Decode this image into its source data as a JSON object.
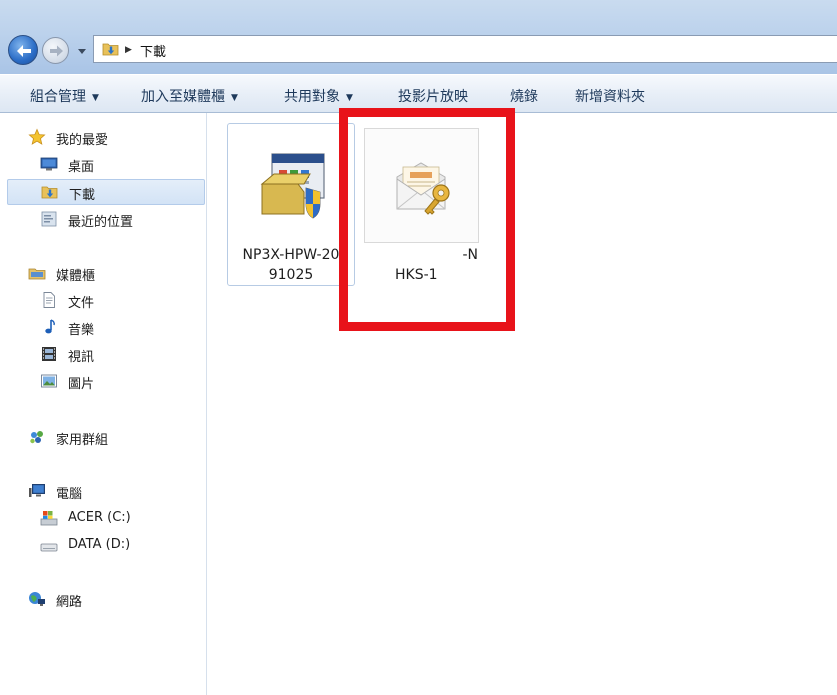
{
  "window": {
    "address": {
      "path": "下載",
      "separator_icon": "chevron-right-icon"
    },
    "buttons": {
      "back_icon": "back-arrow-icon",
      "forward_icon": "forward-arrow-icon",
      "history_icon": "chevron-down-icon"
    }
  },
  "toolbar": {
    "items": [
      {
        "label": "組合管理",
        "has_dropdown": true
      },
      {
        "label": "加入至媒體櫃",
        "has_dropdown": true
      },
      {
        "label": "共用對象",
        "has_dropdown": true
      },
      {
        "label": "投影片放映",
        "has_dropdown": false
      },
      {
        "label": "燒錄",
        "has_dropdown": false
      },
      {
        "label": "新增資料夾",
        "has_dropdown": false
      }
    ],
    "dropdown_glyph": "▼"
  },
  "sidebar": {
    "favorites": {
      "label": "我的最愛",
      "icon": "star-icon",
      "items": [
        {
          "label": "桌面",
          "icon": "desktop-icon"
        },
        {
          "label": "下載",
          "icon": "downloads-folder-icon",
          "selected": true
        },
        {
          "label": "最近的位置",
          "icon": "recent-places-icon"
        }
      ]
    },
    "libraries": {
      "label": "媒體櫃",
      "icon": "library-icon",
      "items": [
        {
          "label": "文件",
          "icon": "document-icon"
        },
        {
          "label": "音樂",
          "icon": "music-icon"
        },
        {
          "label": "視訊",
          "icon": "video-icon"
        },
        {
          "label": "圖片",
          "icon": "picture-icon"
        }
      ]
    },
    "homegroup": {
      "label": "家用群組",
      "icon": "homegroup-icon"
    },
    "computer": {
      "label": "電腦",
      "icon": "computer-icon",
      "items": [
        {
          "label": "ACER (C:)",
          "icon": "system-drive-icon"
        },
        {
          "label": "DATA (D:)",
          "icon": "drive-icon"
        }
      ]
    },
    "network": {
      "label": "網路",
      "icon": "network-icon"
    }
  },
  "files": [
    {
      "name_line1": "NP3X-HPW-20",
      "name_line2": "91025",
      "icon": "installer-icon",
      "selected": true
    },
    {
      "name_line1": "-N",
      "name_line2": "HKS-1",
      "icon": "certificate-envelope-key-icon",
      "selected": false
    }
  ],
  "colors": {
    "highlight": "#e8131a",
    "toolbar_text": "#1e395b",
    "selection_border": "#b3cbea"
  }
}
